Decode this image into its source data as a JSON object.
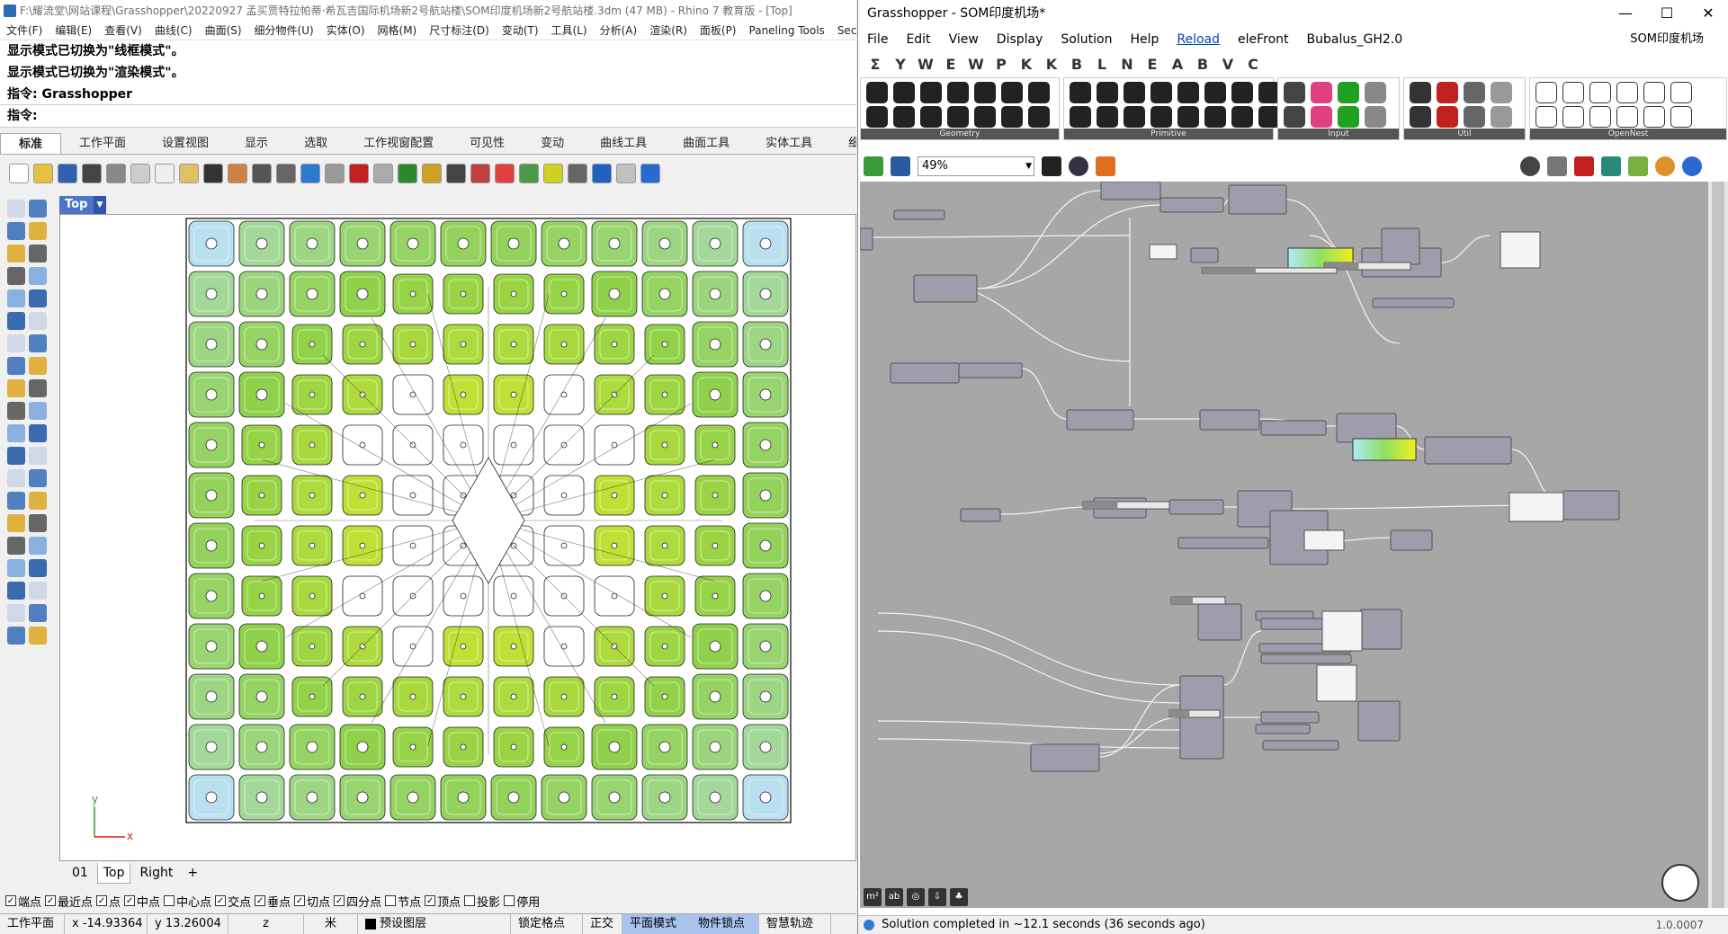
{
  "rhino": {
    "title": "F:\\耀流堂\\网站课程\\Grasshopper\\20220927 孟买贾特拉帕蒂·希瓦吉国际机场新2号航站楼\\SOM印度机场新2号航站楼.3dm (47 MB) - Rhino 7 教育版 - [Top]",
    "menu": [
      "文件(F)",
      "编辑(E)",
      "查看(V)",
      "曲线(C)",
      "曲面(S)",
      "细分物件(U)",
      "实体(O)",
      "网格(M)",
      "尺寸标注(D)",
      "变动(T)",
      "工具(L)",
      "分析(A)",
      "渲染(R)",
      "面板(P)",
      "Paneling Tools",
      "Section"
    ],
    "history": [
      "显示模式已切换为\"线框模式\"。",
      "显示模式已切换为\"渲染模式\"。",
      "指令: Grasshopper"
    ],
    "command_prompt": "指令:",
    "tabs": [
      "标准",
      "工作平面",
      "设置视图",
      "显示",
      "选取",
      "工作视窗配置",
      "可见性",
      "变动",
      "曲线工具",
      "曲面工具",
      "实体工具",
      "细分"
    ],
    "viewport_name": "Top",
    "viewport_tabs": [
      "01",
      "Top",
      "Right",
      "+"
    ],
    "axis_x": "x",
    "axis_y": "y",
    "osnaps": [
      {
        "label": "端点",
        "checked": true
      },
      {
        "label": "最近点",
        "checked": true
      },
      {
        "label": "点",
        "checked": true
      },
      {
        "label": "中点",
        "checked": true
      },
      {
        "label": "中心点",
        "checked": false
      },
      {
        "label": "交点",
        "checked": true
      },
      {
        "label": "垂点",
        "checked": true
      },
      {
        "label": "切点",
        "checked": true
      },
      {
        "label": "四分点",
        "checked": true
      },
      {
        "label": "节点",
        "checked": false
      },
      {
        "label": "顶点",
        "checked": true
      },
      {
        "label": "投影",
        "checked": false
      },
      {
        "label": "停用",
        "checked": false
      }
    ],
    "status": {
      "cplane": "工作平面",
      "x": "x -14.93364",
      "y": "y 13.26004",
      "z": "z",
      "unit": "米",
      "layer": "预设图层",
      "grid_snap": "锁定格点",
      "ortho": "正交",
      "planar": "平面模式",
      "osnap": "物件锁点",
      "smarttrack": "智慧轨迹"
    }
  },
  "grasshopper": {
    "title": "Grasshopper - SOM印度机场*",
    "menu": [
      "File",
      "Edit",
      "View",
      "Display",
      "Solution",
      "Help",
      "Reload",
      "eleFront",
      "Bubalus_GH2.0"
    ],
    "doc_name": "SOM印度机场",
    "categories": [
      "Σ",
      "Y",
      "W",
      "E",
      "W",
      "P",
      "K",
      "K",
      "B",
      "L",
      "N",
      "E",
      "A",
      "B",
      "V",
      "C"
    ],
    "panels": [
      "Geometry",
      "Primitive",
      "Input",
      "Util",
      "OpenNest"
    ],
    "zoom": "49%",
    "status": "Solution completed in ~12.1 seconds (36 seconds ago)",
    "version": "1.0.0007"
  },
  "colors": {
    "tile_blue": "#b9e0f0",
    "tile_green": "#8fd14a",
    "tile_yellow": "#f0f020",
    "gh_canvas": "#a7a7a7",
    "gh_component": "#9d9dac"
  }
}
